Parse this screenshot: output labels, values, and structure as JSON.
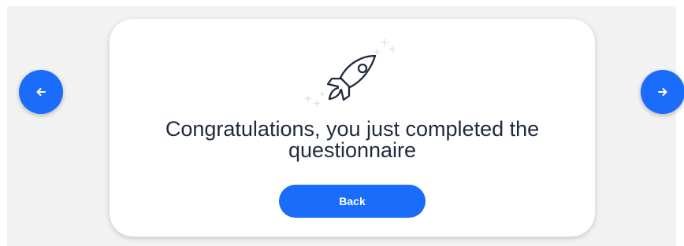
{
  "carousel": {
    "prev_icon": "arrow-left-icon",
    "next_icon": "arrow-right-icon"
  },
  "card": {
    "illustration_icon": "rocket-icon",
    "message_line1": "Congratulations, you just completed the",
    "message_line2": "questionnaire",
    "back_label": "Back"
  },
  "colors": {
    "accent": "#1a6cfb",
    "text": "#1f2a3d",
    "background": "#f2f2f2",
    "card": "#ffffff"
  }
}
